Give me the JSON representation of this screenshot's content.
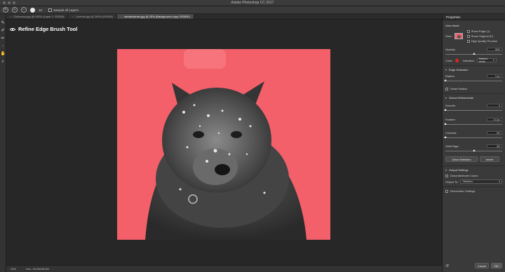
{
  "window": {
    "title": "Adobe Photoshop CC 2017"
  },
  "options_bar": {
    "sample_all_layers_label": "Sample All Layers",
    "brush_size": "10"
  },
  "tabs": [
    {
      "label": "Clubmoss.jpg @ 100% (Layer 1, RGB/8)",
      "active": false
    },
    {
      "label": "Lineerts.jpg @ 200% (RGB/8)",
      "active": false
    },
    {
      "label": "sledsinwinter.jpg @ 25% (Background copy, RGB/8*)",
      "active": true
    }
  ],
  "canvas": {
    "tool_label": "Refine Edge Brush Tool",
    "background_color": "#f4606a"
  },
  "status_bar": {
    "zoom": "25%",
    "doc": "Doc: 28.0M/28.0M"
  },
  "properties": {
    "tab": "Properties",
    "view_mode": {
      "heading": "View Mode",
      "view_label": "View:",
      "show_edge": "Show Edge (J)",
      "show_original": "Show Original (P)",
      "high_quality": "High Quality Preview"
    },
    "opacity": {
      "label": "Opacity:",
      "value": "50%",
      "level": 0.5
    },
    "color_label": "Color:",
    "indicates_label": "Indicates:",
    "indicates_value": "Masked Areas",
    "edge_detection": {
      "heading": "Edge Detection",
      "radius_label": "Radius:",
      "radius_value": "0 px",
      "smart_radius": "Smart Radius"
    },
    "global_refinements": {
      "heading": "Global Refinements",
      "smooth_label": "Smooth:",
      "smooth_value": "0",
      "feather_label": "Feather:",
      "feather_value": "0.0 px",
      "contrast_label": "Contrast:",
      "contrast_value": "0%",
      "shift_edge_label": "Shift Edge:",
      "shift_edge_value": "0%"
    },
    "clear_selection": "Clear Selection",
    "invert": "Invert",
    "output_settings": {
      "heading": "Output Settings",
      "decontaminate": "Decontaminate Colors",
      "output_to_label": "Output To:",
      "output_to_value": "Selection"
    },
    "remember_settings": "Remember Settings",
    "cancel": "Cancel",
    "ok": "OK"
  },
  "colors": {
    "overlay": "#f4606a",
    "indicator": "#e02525",
    "ui_dark": "#262626"
  }
}
